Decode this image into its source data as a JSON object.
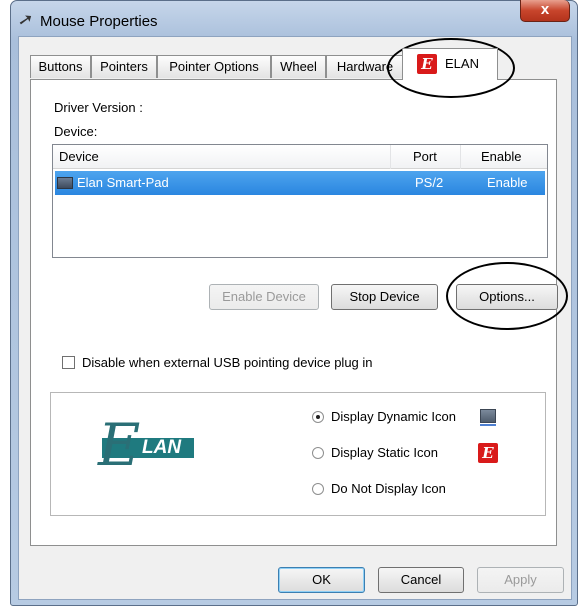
{
  "window": {
    "title": "Mouse Properties",
    "close_label": "x"
  },
  "tabs": [
    {
      "label": "Buttons"
    },
    {
      "label": "Pointers"
    },
    {
      "label": "Pointer Options"
    },
    {
      "label": "Wheel"
    },
    {
      "label": "Hardware"
    },
    {
      "label": "ELAN",
      "selected": true
    }
  ],
  "elan_page": {
    "driver_version_label": "Driver Version :",
    "device_label": "Device:",
    "device_list": {
      "columns": [
        "Device",
        "Port",
        "Enable"
      ],
      "rows": [
        {
          "device": "Elan Smart-Pad",
          "port": "PS/2",
          "enable": "Enable",
          "selected": true
        }
      ]
    },
    "buttons": {
      "enable_device": "Enable Device",
      "stop_device": "Stop Device",
      "options": "Options..."
    },
    "disable_checkbox": {
      "label": "Disable when external USB pointing device plug in",
      "checked": false
    },
    "icon_options": [
      {
        "label": "Display Dynamic Icon",
        "selected": true
      },
      {
        "label": "Display Static Icon",
        "selected": false
      },
      {
        "label": "Do Not Display Icon",
        "selected": false
      }
    ],
    "logo_text": "LAN",
    "logo_letter": "E"
  },
  "footer": {
    "ok": "OK",
    "cancel": "Cancel",
    "apply": "Apply"
  },
  "colors": {
    "selection": "#3393e8",
    "elan_red": "#d91a1a",
    "elan_teal": "#1f7a7f",
    "close_red": "#c8452c"
  }
}
